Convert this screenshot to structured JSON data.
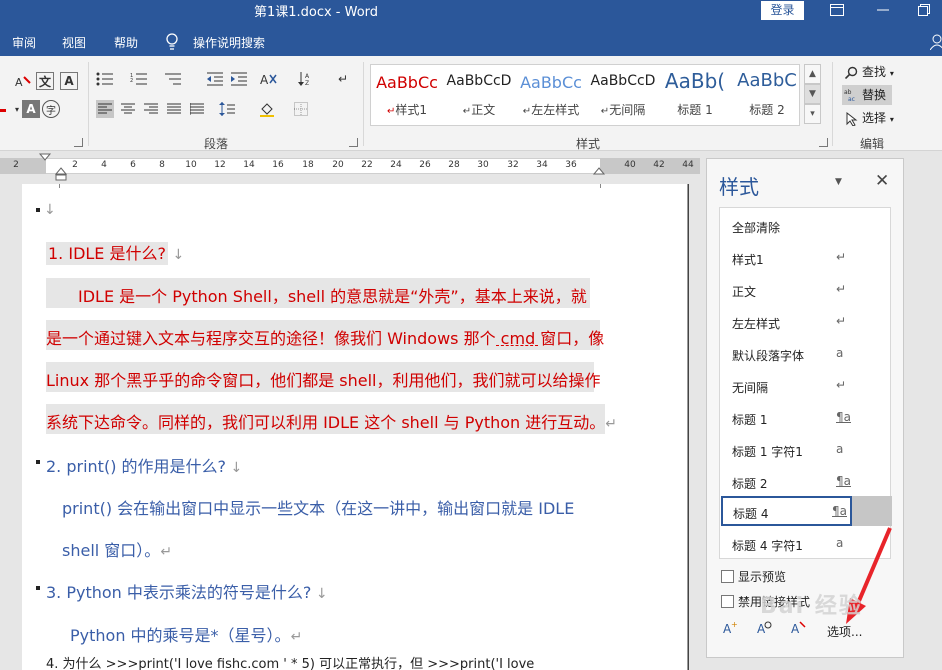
{
  "titlebar": {
    "title": "第1课1.docx - Word",
    "login": "登录"
  },
  "menu": {
    "tabs": [
      "审阅",
      "视图",
      "帮助",
      "操作说明搜索"
    ]
  },
  "ribbon": {
    "paragraph_label": "段落",
    "styles_label": "样式",
    "editing_label": "编辑",
    "styles": [
      {
        "sample": "AaBbCc",
        "name": "样式1",
        "color": "#d00000"
      },
      {
        "sample": "AaBbCcD",
        "name": "正文",
        "color": "#222222"
      },
      {
        "sample": "AaBbCc",
        "name": "左左样式",
        "color": "#5b8fd6"
      },
      {
        "sample": "AaBbCcD",
        "name": "无间隔",
        "color": "#222222"
      },
      {
        "sample": "AaBb(",
        "name": "标题 1",
        "color": "#2e5d9a"
      },
      {
        "sample": "AaBbC",
        "name": "标题 2",
        "color": "#2e5d9a"
      }
    ],
    "editing": {
      "find": "查找",
      "replace": "替换",
      "select": "选择"
    }
  },
  "ruler": {
    "ticks": [
      "2",
      "2",
      "4",
      "6",
      "8",
      "10",
      "12",
      "14",
      "16",
      "18",
      "20",
      "22",
      "24",
      "26",
      "28",
      "30",
      "32",
      "34",
      "36",
      "40",
      "42",
      "44"
    ]
  },
  "document": {
    "lines": [
      {
        "text": "1. IDLE  是什么?",
        "style": "red"
      },
      {
        "text": "IDLE 是一个 Python Shell，shell 的意思就是“外壳”，基本上来说，就",
        "style": "red"
      },
      {
        "text": "是一个通过键入文本与程序交互的途径！像我们 Windows 那个 cmd 窗口，像",
        "style": "red"
      },
      {
        "text": "Linux 那个黑乎乎的命令窗口，他们都是 shell，利用他们，我们就可以给操作",
        "style": "red"
      },
      {
        "text": "系统下达命令。同样的，我们可以利用 IDLE 这个 shell 与 Python 进行互动。",
        "style": "red"
      },
      {
        "text": "2. print()  的作用是什么?",
        "style": "blue"
      },
      {
        "text": "print()  会在输出窗口中显示一些文本（在这一讲中，输出窗口就是 IDLE",
        "style": "blue"
      },
      {
        "text": "shell 窗口）。",
        "style": "blue"
      },
      {
        "text": "3. Python  中表示乘法的符号是什么?",
        "style": "blue"
      },
      {
        "text": "Python 中的乘号是*（星号）。",
        "style": "blue"
      },
      {
        "text": "4.  为什么  >>>print('I love fishc.com ' * 5)  可以正常执行，但  >>>print('I love",
        "style": "black"
      }
    ]
  },
  "styles_pane": {
    "title": "样式",
    "items": [
      {
        "name": "全部清除",
        "icon": ""
      },
      {
        "name": "样式1",
        "icon": "↵"
      },
      {
        "name": "正文",
        "icon": "↵"
      },
      {
        "name": "左左样式",
        "icon": "↵"
      },
      {
        "name": "默认段落字体",
        "icon": "a"
      },
      {
        "name": "无间隔",
        "icon": "↵"
      },
      {
        "name": "标题 1",
        "icon": "¶a"
      },
      {
        "name": "标题 1 字符1",
        "icon": "a"
      },
      {
        "name": "标题 2",
        "icon": "¶a"
      },
      {
        "name": "标题 4",
        "icon": "¶a"
      },
      {
        "name": "标题 4 字符1",
        "icon": "a"
      }
    ],
    "show_preview": "显示预览",
    "disable_linked": "禁用链接样式",
    "options": "选项..."
  },
  "watermark": "Bai 经验"
}
